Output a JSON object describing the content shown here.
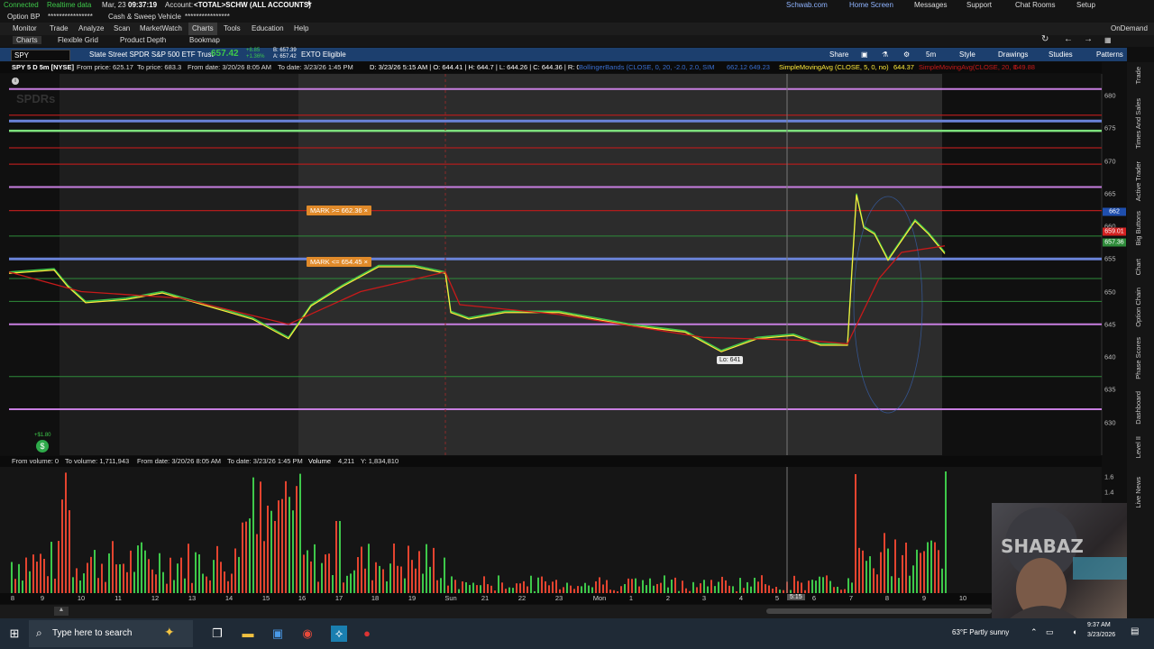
{
  "status": {
    "connection": "Connected",
    "realtime": "Realtime data",
    "date": "Mar, 23",
    "time": "09:37:19",
    "account_label": "Account:",
    "account_value": "<TOTAL>SCHW (ALL ACCOUNTS)",
    "add": "+",
    "links": [
      "Schwab.com",
      "Home Screen",
      "Messages",
      "Support",
      "Chat Rooms",
      "Setup"
    ]
  },
  "account_bar": {
    "option_bp_label": "Option BP",
    "option_bp_value": "****************",
    "cash_label": "Cash & Sweep Vehicle",
    "cash_value": "****************"
  },
  "menu": {
    "items": [
      "Monitor",
      "Trade",
      "Analyze",
      "Scan",
      "MarketWatch",
      "Charts",
      "Tools",
      "Education",
      "Help"
    ],
    "active": "Charts",
    "ondemand": "OnDemand"
  },
  "subtabs": {
    "items": [
      "Charts",
      "Flexible Grid",
      "Product Depth",
      "Bookmap"
    ]
  },
  "symbol_bar": {
    "symbol": "SPY",
    "description": "State Street SPDR S&P 500 ETF Trust",
    "last": "657.42",
    "change_top": "+8.85",
    "change_pct": "+1.36%",
    "bid_label": "B: 657.39",
    "ask_label": "A: 657.42",
    "ext": "EXTO Eligible",
    "buttons": [
      "Share",
      "5m",
      "Style",
      "Drawings",
      "Studies",
      "Patterns"
    ]
  },
  "info_bar": {
    "title": "SPY 5 D 5m [NYSE]",
    "from_price": "From price: 625.17",
    "to_price": "To price: 683.3",
    "from_date": "From date: 3/20/26 8:05 AM",
    "to_date": "To date: 3/23/26 1:45 PM",
    "ohlc": "D: 3/23/26 5:15 AM | O: 644.41 | H: 644.7 | L: 644.26 | C: 644.36 | R: 0.44",
    "bb": "BollingerBands (CLOSE, 0, 20, -2.0, 2.0, SIMPLE)",
    "bb_vals": "662.12  649.23",
    "sma": "SimpleMovingAvg (CLOSE, 5, 0, no)",
    "sma_val": "644.37",
    "sma2": "SimpleMovingAvg(CLOSE, 20, 0, no)",
    "sma2_val": "649.88"
  },
  "chart": {
    "price_ticks": [
      "680",
      "675",
      "670",
      "665",
      "660",
      "655",
      "650",
      "645",
      "640",
      "635",
      "630"
    ],
    "price_labels": [
      {
        "text": "662",
        "color": "#1f4fae"
      },
      {
        "text": "659.01",
        "color": "#d32020"
      },
      {
        "text": "657.36",
        "color": "#2e8b3a"
      }
    ],
    "marks": [
      "MARK >= 662.36",
      "MARK <= 654.45"
    ],
    "lo_label": "Lo: 641",
    "corner_value": "+$1.80",
    "watermark": "SPDRs",
    "colors": {
      "up": "#3ec84a",
      "down": "#e4442f",
      "sma_fast": "#ffeb3b",
      "sma_slow": "#c81a1a",
      "bb": "#3a6fd0"
    }
  },
  "volume_bar": {
    "from_vol": "From volume: 0",
    "to_vol": "To volume: 1,711,943",
    "from_date": "From date: 3/20/26 8:05 AM",
    "to_date": "To date: 3/23/26 1:45 PM",
    "label": "Volume",
    "value": "4,211",
    "y": "Y: 1,834,810",
    "axis": [
      "1.6",
      "1.4"
    ]
  },
  "time_axis": [
    "8",
    "9",
    "10",
    "11",
    "12",
    "13",
    "14",
    "15",
    "16",
    "17",
    "18",
    "19",
    "Sun",
    "21",
    "22",
    "23",
    "Mon",
    "1",
    "2",
    "3",
    "4",
    "5",
    "6",
    "7",
    "8",
    "9",
    "10"
  ],
  "cursor_time": "5:15",
  "right_tabs": [
    "Trade",
    "Times And Sales",
    "Active Trader",
    "Big Buttons",
    "Chart",
    "Option Chain",
    "Phase Scores",
    "Dashboard",
    "Level II",
    "Live News"
  ],
  "taskbar": {
    "search_placeholder": "Type here to search",
    "weather": "63°F  Partly sunny",
    "time": "9:37 AM",
    "date": "3/23/2026"
  }
}
